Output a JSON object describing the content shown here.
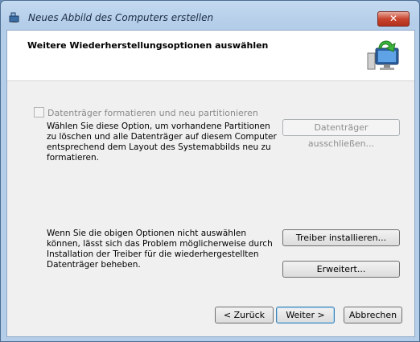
{
  "window": {
    "title": "Neues Abbild des Computers erstellen",
    "close_label": "✕"
  },
  "header": {
    "title": "Weitere Wiederherstellungsoptionen auswählen",
    "icon": "computer-restore-icon"
  },
  "format_option": {
    "checkbox_label": "Datenträger formatieren und neu partitionieren",
    "checked": false,
    "enabled": false,
    "description": "Wählen Sie diese Option, um vorhandene Partitionen zu löschen und alle Datenträger auf diesem Computer entsprechend dem Layout des Systemabbilds neu zu formatieren.",
    "exclude_button": "Datenträger ausschließen..."
  },
  "driver_info": {
    "description": "Wenn Sie die obigen Optionen nicht auswählen können, lässt sich das Problem möglicherweise durch Installation der Treiber für die wiederhergestellten Datenträger beheben.",
    "install_button": "Treiber installieren...",
    "advanced_button": "Erweitert..."
  },
  "footer": {
    "back_button": "< Zurück",
    "next_button": "Weiter >",
    "cancel_button": "Abbrechen"
  }
}
